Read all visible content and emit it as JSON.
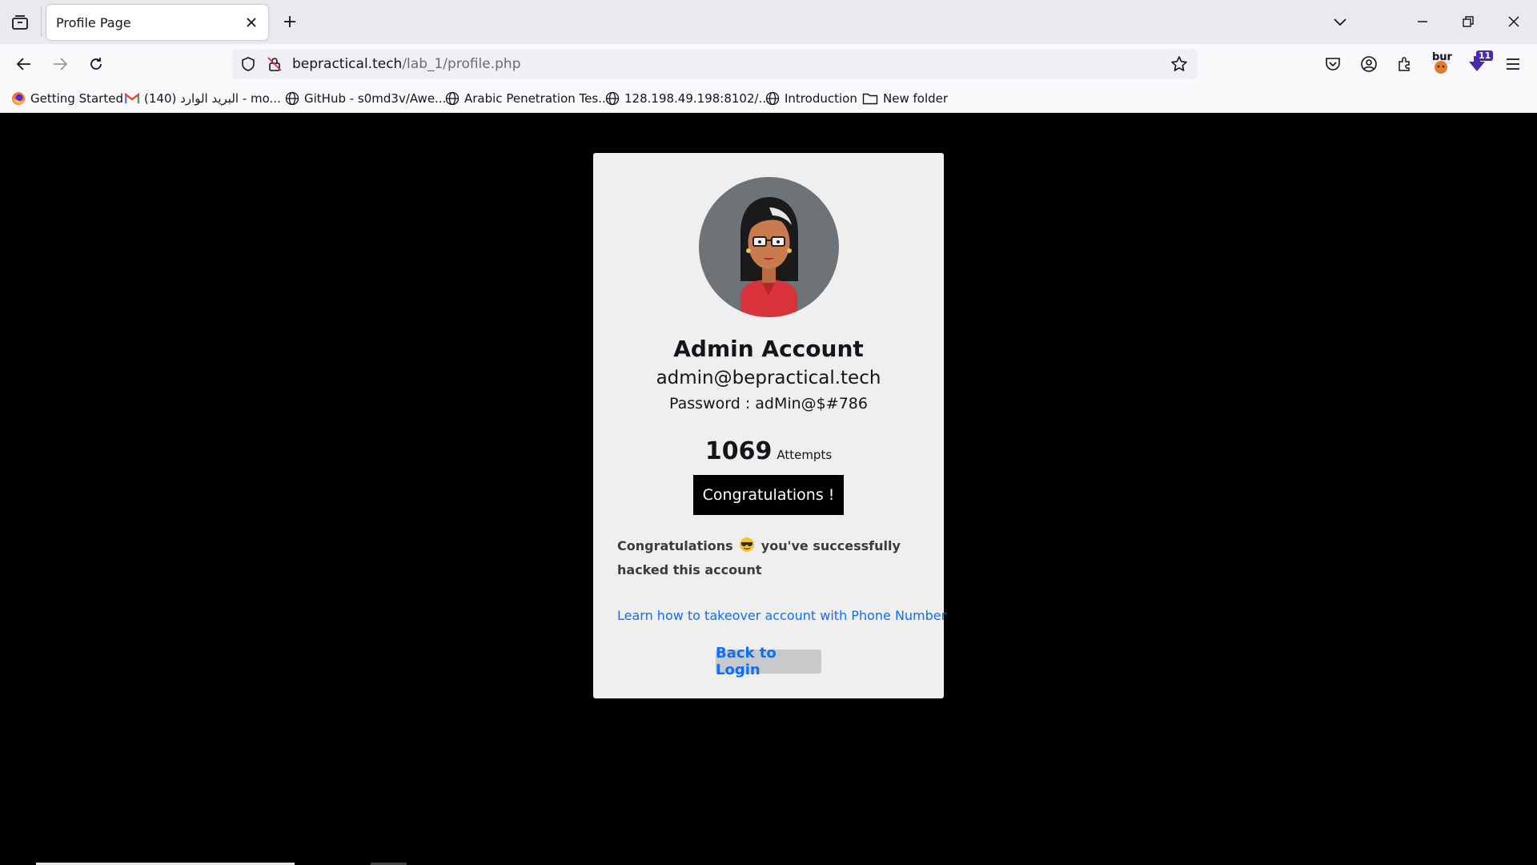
{
  "tab": {
    "title": "Profile Page"
  },
  "url": {
    "domain": "bepractical.tech",
    "path": "/lab_1/profile.php"
  },
  "bookmarks": [
    {
      "label": "Getting Started",
      "icon": "firefox-icon"
    },
    {
      "label": "البريد الوارد (140) - mo...",
      "icon": "gmail-icon"
    },
    {
      "label": "GitHub - s0md3v/Awe...",
      "icon": "globe-icon"
    },
    {
      "label": "Arabic Penetration Tes...",
      "icon": "globe-icon"
    },
    {
      "label": "128.198.49.198:8102/...",
      "icon": "globe-icon"
    },
    {
      "label": "Introduction",
      "icon": "globe-icon"
    },
    {
      "label": "New folder",
      "icon": "folder-icon"
    }
  ],
  "extensions": {
    "burp_label": "bur",
    "badge_count": "11"
  },
  "profile": {
    "name": "Admin Account",
    "email": "admin@bepractical.tech",
    "password_label": "Password : ",
    "password_value": "adMin@$#786",
    "attempts_count": "1069",
    "attempts_label": "Attempts",
    "congrats_button": "Congratulations !",
    "message_before": "Congratulations",
    "message_emoji": "smiling-face-with-sunglasses-emoji",
    "message_after": "you've successfully hacked this account",
    "learn_link": "Learn how to takeover account with Phone Number",
    "back_button": "Back to Login"
  },
  "colors": {
    "link": "#0d6efd",
    "card": "#efefef",
    "page_bg": "#000000",
    "avatar_bg": "#6e7378"
  }
}
